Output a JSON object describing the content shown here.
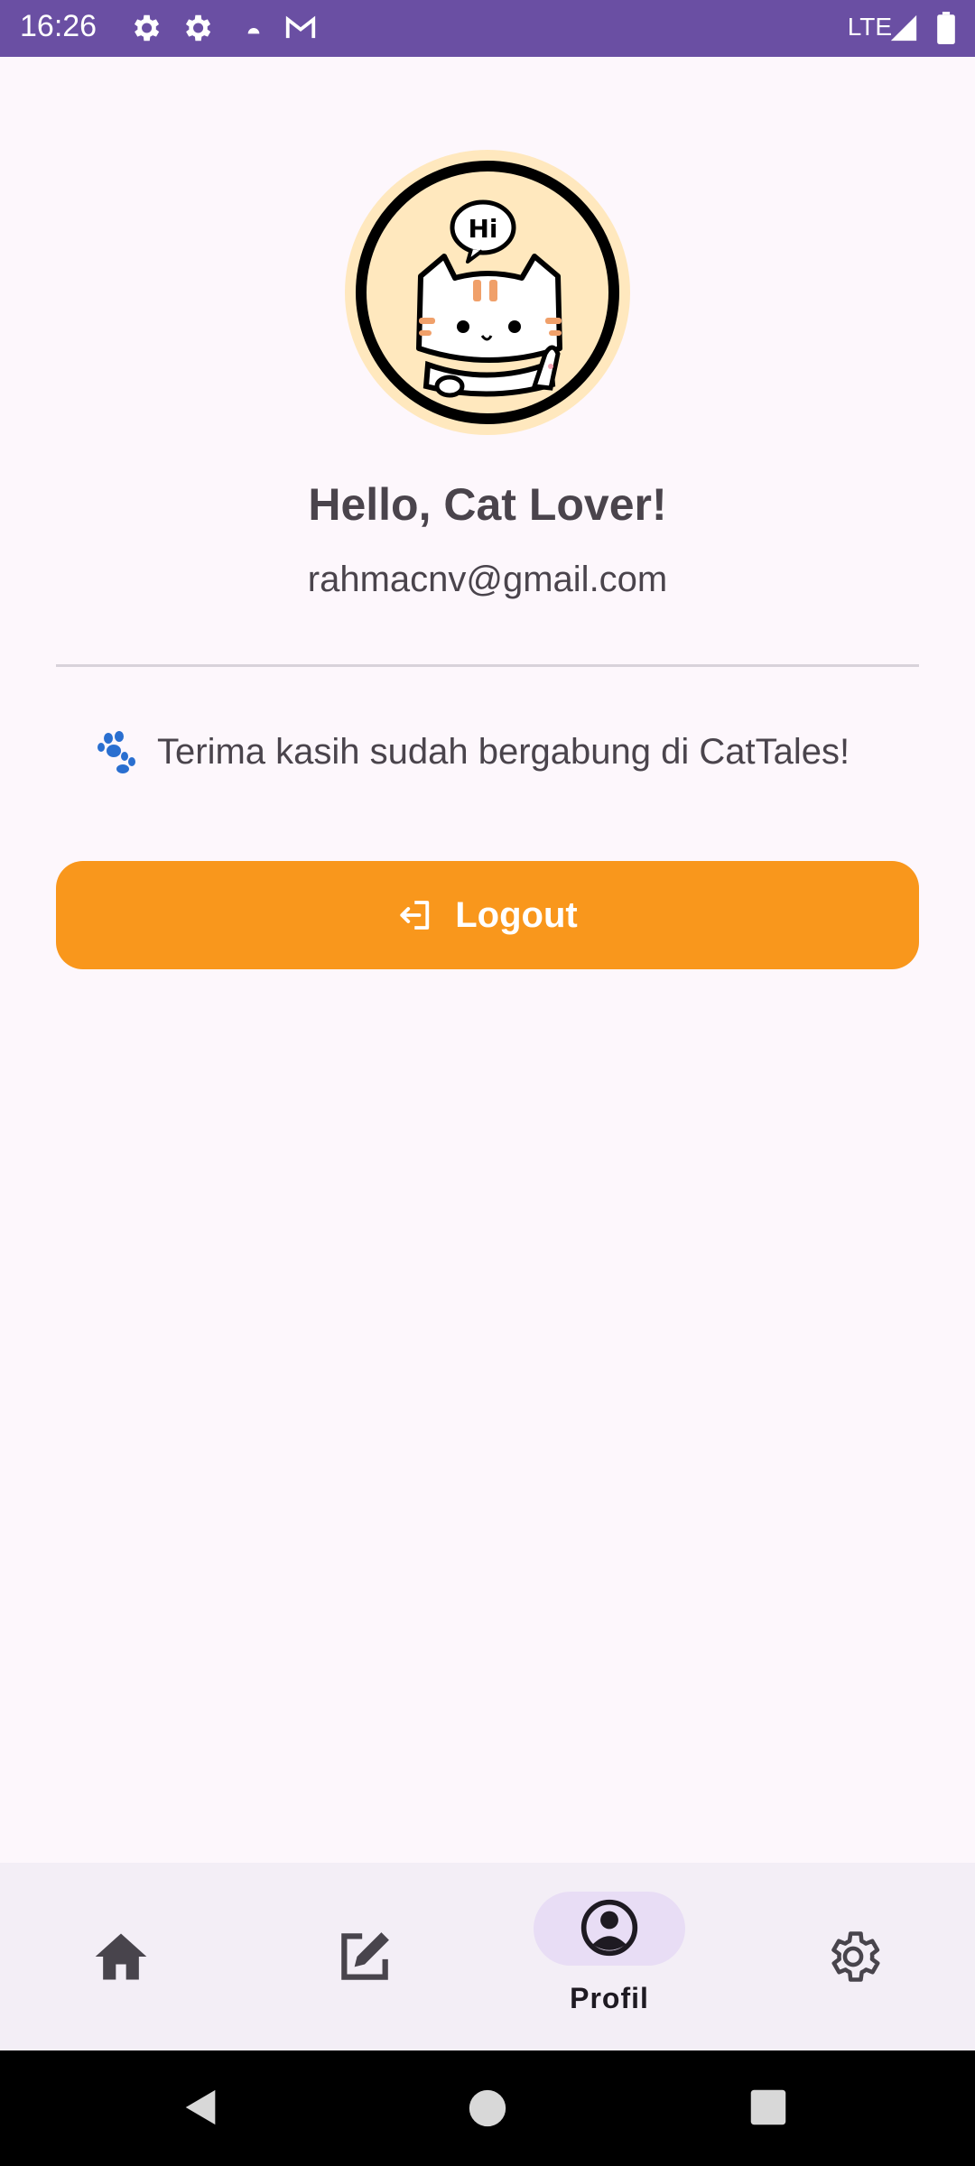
{
  "status_bar": {
    "time": "16:26",
    "network": "LTE",
    "icons": [
      "settings-icon",
      "settings-icon",
      "cloud-icon",
      "gmail-icon",
      "signal-icon",
      "battery-icon"
    ]
  },
  "profile": {
    "avatar_bubble_text": "Hi",
    "greeting": "Hello, Cat Lover!",
    "email": "rahmacnv@gmail.com",
    "thanks_message": "Terima kasih sudah bergabung di CatTales!",
    "logout_label": "Logout"
  },
  "bottom_nav": {
    "items": [
      {
        "icon": "home-icon",
        "label": ""
      },
      {
        "icon": "edit-icon",
        "label": ""
      },
      {
        "icon": "profile-icon",
        "label": "Profil",
        "active": true
      },
      {
        "icon": "gear-icon",
        "label": ""
      }
    ]
  },
  "colors": {
    "status_bar": "#6A4FA3",
    "background": "#FDF7FC",
    "accent": "#F9971C",
    "avatar_bg": "#FFE8BE",
    "nav_bg": "#F3EEF6",
    "nav_active_pill": "#E8DDF5"
  }
}
